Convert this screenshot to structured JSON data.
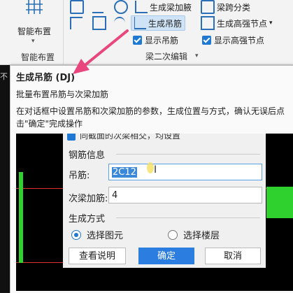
{
  "ribbon": {
    "smart_layout_label": "智能布置",
    "group_smart_layout": "智能布置",
    "gen_waist_bar": "生成梁加腋",
    "beam_span_classify": "梁跨分类",
    "gen_hanger_bar": "生成吊筋",
    "gen_high_strength_node": "生成高强节点",
    "show_hanger_bar": "显示吊筋",
    "show_high_strength_node": "显示高强节点",
    "group_beam_edit": "梁二次编辑"
  },
  "tooltip": {
    "title": "生成吊筋 (DJ)",
    "subtitle": "批量布置吊筋与次梁加筋",
    "description": "在对话框中设置吊筋和次梁加筋的参数，生成位置与方式，确认无误后点击\"确定\"完成操作"
  },
  "dialog": {
    "top_text": "同截面的次梁相交，均设置",
    "section_rebar": "钢筋信息",
    "hanger_label": "吊筋:",
    "hanger_value": "2C12",
    "sec_beam_label": "次梁加筋:",
    "sec_beam_value": "4",
    "section_method": "生成方式",
    "radio_select_element": "选择图元",
    "radio_select_floor": "选择楼层",
    "help_button": "查看说明",
    "ok_button": "确定",
    "cancel_button": "取消"
  },
  "colors": {
    "accent": "#2c7de0",
    "arrow": "#e8467c",
    "green": "#2ed12e"
  }
}
